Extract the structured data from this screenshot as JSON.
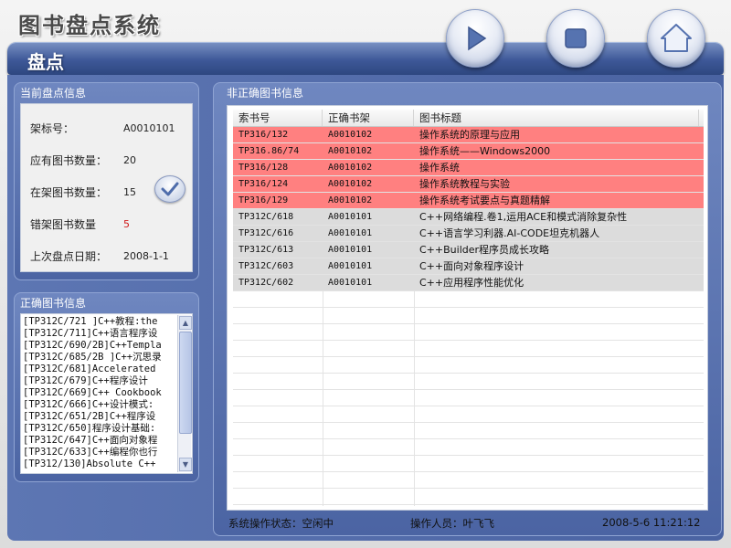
{
  "app": {
    "title": "图书盘点系统",
    "banner": "盘点"
  },
  "toolbar": {
    "buttons": [
      {
        "name": "play",
        "icon": "play-icon"
      },
      {
        "name": "stop",
        "icon": "stop-icon"
      },
      {
        "name": "home",
        "icon": "home-icon"
      }
    ]
  },
  "current": {
    "title": "当前盘点信息",
    "shelf_label": "架标号：",
    "shelf_value": "A0010101",
    "expected_label": "应有图书数量：",
    "expected_value": "20",
    "onshelf_label": "在架图书数量：",
    "onshelf_value": "15",
    "misplaced_label": "错架图书数量",
    "misplaced_value": "5",
    "last_date_label": "上次盘点日期：",
    "last_date_value": "2008-1-1",
    "confirm_icon": "check-icon"
  },
  "correct": {
    "title": "正确图书信息",
    "items": [
      "[TP312C/721 ]C++教程:the",
      "[TP312C/711]C++语言程序设",
      "[TP312C/690/2B]C++Templa",
      "[TP312C/685/2B ]C++沉思录",
      "[TP312C/681]Accelerated",
      "[TP312C/679]C++程序设计",
      "[TP312C/669]C++ Cookbook",
      "[TP312C/666]C++设计模式:",
      "[TP312C/651/2B]C++程序设",
      "[TP312C/650]程序设计基础:",
      "[TP312C/647]C++面向对象程",
      "[TP312C/633]C++编程你也行",
      "[TP312/130]Absolute C++"
    ]
  },
  "wrong": {
    "title": "非正确图书信息",
    "columns": [
      "索书号",
      "正确书架",
      "图书标题"
    ],
    "highlight_color": "#ff8080",
    "normal_color": "#dcdcdc",
    "rows": [
      {
        "call": "TP316/132",
        "shelf": "A0010102",
        "title": "操作系统的原理与应用",
        "error": true
      },
      {
        "call": "TP316.86/74",
        "shelf": "A0010102",
        "title": "操作系统——Windows2000",
        "error": true
      },
      {
        "call": "TP316/128",
        "shelf": "A0010102",
        "title": "操作系统",
        "error": true
      },
      {
        "call": "TP316/124",
        "shelf": "A0010102",
        "title": "操作系统教程与实验",
        "error": true
      },
      {
        "call": "TP316/129",
        "shelf": "A0010102",
        "title": "操作系统考试要点与真题精解",
        "error": true
      },
      {
        "call": "TP312C/618",
        "shelf": "A0010101",
        "title": "C++网络编程.卷1,运用ACE和模式消除复杂性",
        "error": false
      },
      {
        "call": "TP312C/616",
        "shelf": "A0010101",
        "title": "C++语言学习利器.AI-CODE坦克机器人",
        "error": false
      },
      {
        "call": "TP312C/613",
        "shelf": "A0010101",
        "title": "C++Builder程序员成长攻略",
        "error": false
      },
      {
        "call": "TP312C/603",
        "shelf": "A0010101",
        "title": "C++面向对象程序设计",
        "error": false
      },
      {
        "call": "TP312C/602",
        "shelf": "A0010101",
        "title": "C++应用程序性能优化",
        "error": false
      }
    ]
  },
  "status": {
    "state": "系统操作状态：空闲中",
    "operator": "操作人员：叶飞飞",
    "datetime": "2008-5-6  11:21:12"
  }
}
